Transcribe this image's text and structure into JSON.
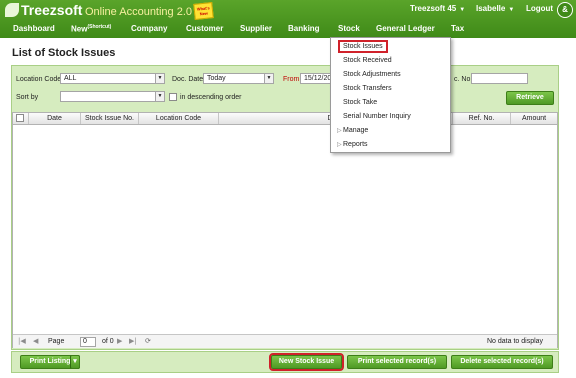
{
  "header": {
    "logo_text": "Treezsoft",
    "app_title": "Online Accounting 2.0",
    "whats_new": "What's New",
    "company": "Treezsoft 45",
    "user": "Isabelle",
    "logout": "Logout"
  },
  "nav": {
    "items": [
      "Dashboard",
      "New",
      "Company",
      "Customer",
      "Supplier",
      "Banking",
      "Stock",
      "General Ledger",
      "Tax"
    ],
    "new_shortcut": "(Shortcut)"
  },
  "page_title": "List of Stock Issues",
  "filters": {
    "location_code_label": "Location Code",
    "location_code_value": "ALL",
    "doc_date_label": "Doc. Date",
    "doc_date_value": "Today",
    "from_label": "From",
    "from_value": "15/12/2013",
    "doc_no_label": "c. No.",
    "doc_no_value": "",
    "sort_by_label": "Sort by",
    "sort_by_value": "",
    "descending_label": "in descending order",
    "retrieve_label": "Retrieve"
  },
  "grid": {
    "columns": [
      "Date",
      "Stock Issue No.",
      "Location Code",
      "Desc",
      "Ref. No.",
      "Amount"
    ],
    "rows": []
  },
  "pager": {
    "page_label": "Page",
    "page_value": "0",
    "of_label": "of 0",
    "status": "No data to display"
  },
  "footer": {
    "print_listing": "Print Listing",
    "new_stock_issue": "New Stock Issue",
    "print_selected": "Print selected record(s)",
    "delete_selected": "Delete selected record(s)"
  },
  "stock_menu": {
    "items": [
      "Stock Issues",
      "Stock Received",
      "Stock Adjustments",
      "Stock Transfers",
      "Stock Take",
      "Serial Number Inquiry",
      "Manage",
      "Reports"
    ]
  },
  "colors": {
    "brand_green": "#4f9a24",
    "panel_green": "#d6ecbf",
    "highlight_red": "#d0212a"
  }
}
